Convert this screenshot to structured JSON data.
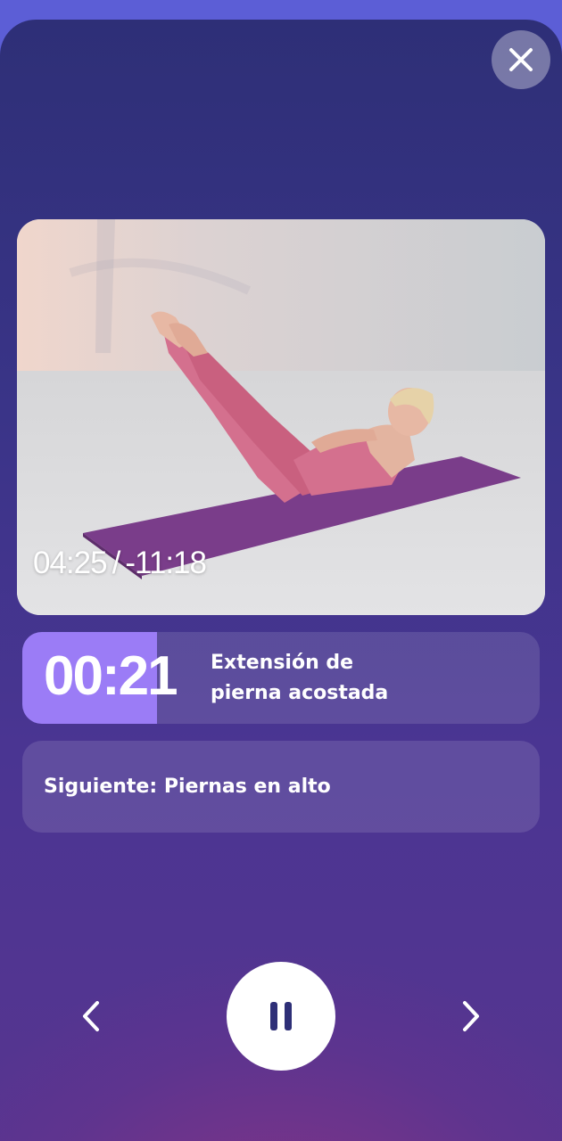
{
  "player": {
    "elapsed": "04:25",
    "separator": "/",
    "remaining": "-11:18"
  },
  "exercise": {
    "timer": "00:21",
    "name_line1": "Extensión de",
    "name_line2": "pierna acostada",
    "progress_fraction": 0.26
  },
  "next": {
    "label": "Siguiente: Piernas en alto"
  },
  "icons": {
    "close": "close-icon",
    "previous": "chevron-left-icon",
    "pause": "pause-icon",
    "next": "chevron-right-icon"
  },
  "colors": {
    "accent": "#9b7cf6",
    "background_top": "#2e2f77",
    "background_bottom": "#573590",
    "mat": "#7a3d8a",
    "outfit": "#d4708e"
  }
}
